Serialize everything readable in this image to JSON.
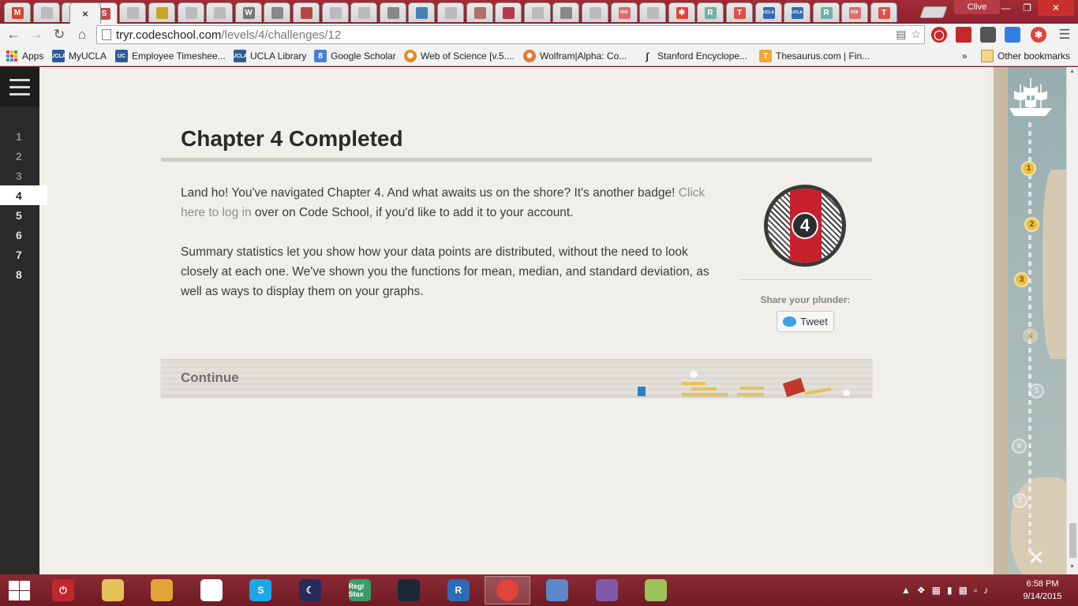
{
  "browser": {
    "profile_name": "Clive",
    "active_tab_close": "×",
    "tabs": [
      {
        "icon": "gmail-icon",
        "glyph": "M",
        "color": "#d14836"
      },
      {
        "icon": "page-icon",
        "glyph": "",
        "color": "#bbbbbb"
      },
      {
        "icon": "page-icon",
        "glyph": "",
        "color": "#bbbbbb"
      },
      {
        "icon": "scribd-icon",
        "glyph": "S",
        "color": "#c14b4b"
      },
      {
        "icon": "page-icon",
        "glyph": "",
        "color": "#bbbbbb"
      },
      {
        "icon": "ucla-icon",
        "glyph": "",
        "color": "#c9a227"
      },
      {
        "icon": "page-icon",
        "glyph": "",
        "color": "#bbbbbb"
      },
      {
        "icon": "page-icon",
        "glyph": "",
        "color": "#bbbbbb"
      },
      {
        "icon": "wikipedia-icon",
        "glyph": "W",
        "color": "#777777"
      },
      {
        "icon": "link-icon",
        "glyph": "",
        "color": "#888888"
      },
      {
        "icon": "tool-icon",
        "glyph": "",
        "color": "#b74545"
      },
      {
        "icon": "page-icon",
        "glyph": "",
        "color": "#bbbbbb"
      },
      {
        "icon": "page-icon",
        "glyph": "",
        "color": "#bbbbbb"
      },
      {
        "icon": "link-icon",
        "glyph": "",
        "color": "#888888"
      },
      {
        "icon": "circle-icon",
        "glyph": "",
        "color": "#4a7fb5"
      },
      {
        "icon": "page-icon",
        "glyph": "",
        "color": "#bbbbbb"
      },
      {
        "icon": "journal-icon",
        "glyph": "",
        "color": "#b0706a"
      },
      {
        "icon": "flag-icon",
        "glyph": "",
        "color": "#b53a4a"
      },
      {
        "icon": "page-icon",
        "glyph": "",
        "color": "#bbbbbb"
      },
      {
        "icon": "gear-icon",
        "glyph": "",
        "color": "#888888"
      },
      {
        "icon": "page-icon",
        "glyph": "",
        "color": "#bbbbbb"
      },
      {
        "icon": "pdf-icon",
        "glyph": "PDF",
        "color": "#e06b6b"
      },
      {
        "icon": "page-icon",
        "glyph": "",
        "color": "#bbbbbb"
      },
      {
        "icon": "asterisk-icon",
        "glyph": "✱",
        "color": "#e0433a"
      },
      {
        "icon": "rstudio-icon",
        "glyph": "R",
        "color": "#6fb0a8"
      },
      {
        "icon": "t-icon",
        "glyph": "T",
        "color": "#d9534f"
      },
      {
        "icon": "ucla-icon",
        "glyph": "UCLA",
        "color": "#2f6fb2"
      },
      {
        "icon": "ucla-icon",
        "glyph": "UCLA",
        "color": "#2f6fb2"
      },
      {
        "icon": "rstudio-icon",
        "glyph": "R",
        "color": "#6fb0a8"
      },
      {
        "icon": "pdf-icon",
        "glyph": "PDF",
        "color": "#e06b6b"
      },
      {
        "icon": "t-icon",
        "glyph": "T",
        "color": "#d9534f"
      }
    ],
    "url_host": "tryr.codeschool.com",
    "url_path": "/levels/4/challenges/12",
    "bookmarks": [
      {
        "label": "Apps"
      },
      {
        "label": "MyUCLA",
        "color": "#2f5a98",
        "glyph": "UCLA"
      },
      {
        "label": "Employee Timeshee...",
        "color": "#2f5a98",
        "glyph": "UC"
      },
      {
        "label": "UCLA Library",
        "color": "#2f5a98",
        "glyph": "UCLA"
      },
      {
        "label": "Google Scholar",
        "color": "#4a7fd4",
        "glyph": "8"
      },
      {
        "label": "Web of Science [v.5....",
        "color": "#e08a2b",
        "glyph": "✺"
      },
      {
        "label": "Wolfram|Alpha: Co...",
        "color": "#e07a2b",
        "glyph": "✹"
      },
      {
        "label": "Stanford Encyclope...",
        "color": "#555555",
        "glyph": "ʃ"
      },
      {
        "label": "Thesaurus.com | Fin...",
        "color": "#f0a830",
        "glyph": "T"
      }
    ],
    "bookmarks_overflow": "»",
    "other_bookmarks": "Other bookmarks"
  },
  "page": {
    "levels": [
      "1",
      "2",
      "3",
      "4",
      "5",
      "6",
      "7",
      "8"
    ],
    "current_level": "4",
    "title": "Chapter 4 Completed",
    "para1_before": "Land ho! You've navigated Chapter 4. And what awaits us on the shore? It's another badge! ",
    "para1_link": "Click here to log in",
    "para1_after": " over on Code School, if you'd like to add it to your account.",
    "para2": "Summary statistics let you show how your data points are distributed, without the need to look closely at each one. We've shown you the functions for mean, median, and standard deviation, as well as ways to display them on your graphs.",
    "badge_number": "4",
    "share_label": "Share your plunder:",
    "tweet_label": "Tweet",
    "continue_label": "Continue",
    "map_pins": [
      "1",
      "2",
      "3",
      "4",
      "5",
      "6",
      "7"
    ],
    "map_end": "✕"
  },
  "taskbar": {
    "apps": [
      {
        "icon": "power-icon",
        "glyph": "⏻",
        "color": "#c0282d"
      },
      {
        "icon": "file-explorer-icon",
        "glyph": "",
        "color": "#e6c35a"
      },
      {
        "icon": "notes-icon",
        "glyph": "",
        "color": "#e0a43a"
      },
      {
        "icon": "tiles-icon",
        "glyph": "",
        "color": "#ffffff"
      },
      {
        "icon": "skype-icon",
        "glyph": "S",
        "color": "#1ba7e8"
      },
      {
        "icon": "stellarium-icon",
        "glyph": "☾",
        "color": "#2a2a5a"
      },
      {
        "icon": "registax-icon",
        "glyph": "Regi Stax",
        "color": "#3b9b6b"
      },
      {
        "icon": "steam-icon",
        "glyph": "",
        "color": "#1b2838"
      },
      {
        "icon": "r-icon",
        "glyph": "R",
        "color": "#2d6bb5"
      },
      {
        "icon": "chrome-icon",
        "glyph": "",
        "color": "#e0443a"
      },
      {
        "icon": "control-panel-icon",
        "glyph": "",
        "color": "#5a88c8"
      },
      {
        "icon": "github-icon",
        "glyph": "",
        "color": "#7d5aa8"
      },
      {
        "icon": "sync-icon",
        "glyph": "",
        "color": "#9bc35a"
      }
    ],
    "time": "6:58 PM",
    "date": "9/14/2015"
  }
}
